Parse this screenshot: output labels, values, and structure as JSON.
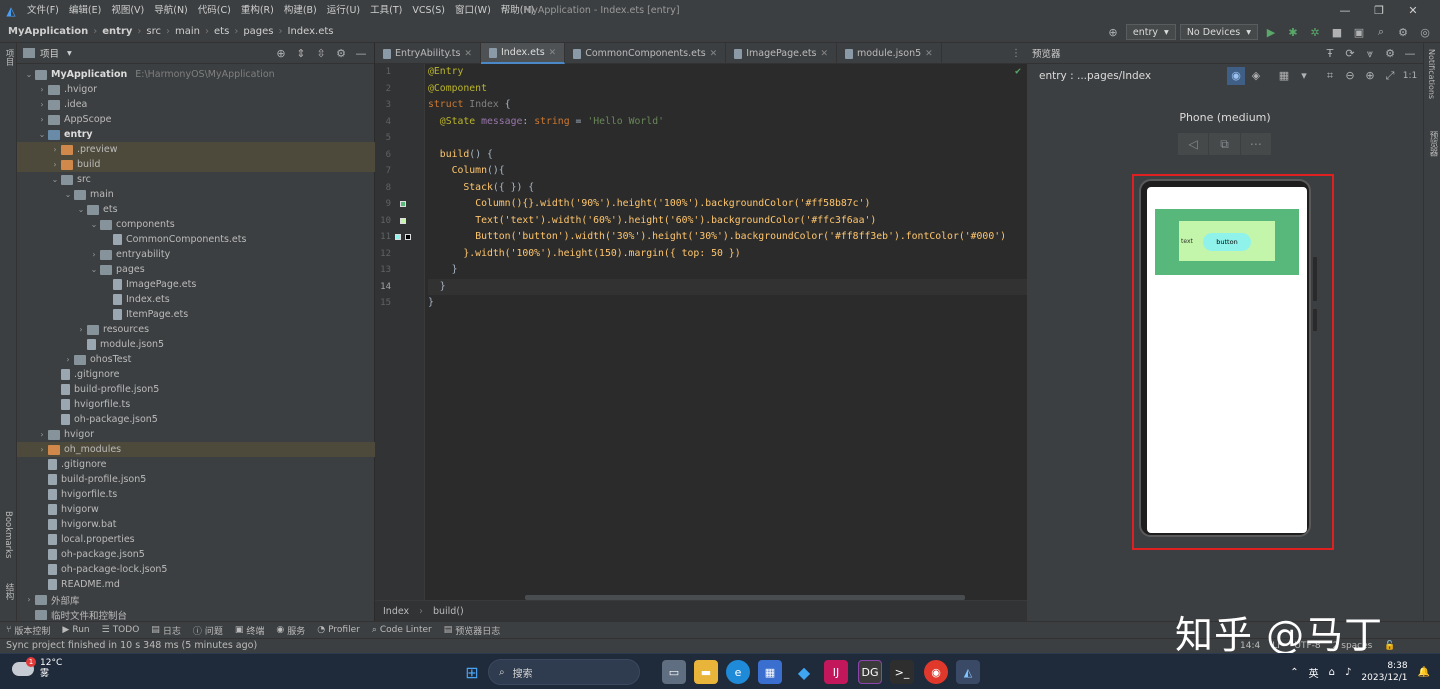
{
  "menubar": {
    "items": [
      "文件(F)",
      "编辑(E)",
      "视图(V)",
      "导航(N)",
      "代码(C)",
      "重构(R)",
      "构建(B)",
      "运行(U)",
      "工具(T)",
      "VCS(S)",
      "窗口(W)",
      "帮助(H)"
    ],
    "window_title": "MyApplication - Index.ets [entry]"
  },
  "navbar": {
    "crumbs": [
      "MyApplication",
      "entry",
      "src",
      "main",
      "ets",
      "pages",
      "Index.ets"
    ],
    "run_config": "entry",
    "devices": "No Devices"
  },
  "left_strip": {
    "top_label": "项目",
    "bookmarks": "Bookmarks",
    "structure": "结构"
  },
  "project": {
    "title": "项目",
    "nodes": [
      {
        "label": "MyApplication",
        "path": "E:\\HarmonyOS\\MyApplication"
      },
      {
        "label": ".hvigor"
      },
      {
        "label": ".idea"
      },
      {
        "label": "AppScope"
      },
      {
        "label": "entry"
      },
      {
        "label": ".preview"
      },
      {
        "label": "build"
      },
      {
        "label": "src"
      },
      {
        "label": "main"
      },
      {
        "label": "ets"
      },
      {
        "label": "components"
      },
      {
        "label": "CommonComponents.ets"
      },
      {
        "label": "entryability"
      },
      {
        "label": "pages"
      },
      {
        "label": "ImagePage.ets"
      },
      {
        "label": "Index.ets"
      },
      {
        "label": "ItemPage.ets"
      },
      {
        "label": "resources"
      },
      {
        "label": "module.json5"
      },
      {
        "label": "ohosTest"
      },
      {
        "label": ".gitignore"
      },
      {
        "label": "build-profile.json5"
      },
      {
        "label": "hvigorfile.ts"
      },
      {
        "label": "oh-package.json5"
      },
      {
        "label": "hvigor"
      },
      {
        "label": "oh_modules"
      },
      {
        "label": ".gitignore"
      },
      {
        "label": "build-profile.json5"
      },
      {
        "label": "hvigorfile.ts"
      },
      {
        "label": "hvigorw"
      },
      {
        "label": "hvigorw.bat"
      },
      {
        "label": "local.properties"
      },
      {
        "label": "oh-package.json5"
      },
      {
        "label": "oh-package-lock.json5"
      },
      {
        "label": "README.md"
      },
      {
        "label": "外部库"
      },
      {
        "label": "临时文件和控制台"
      }
    ]
  },
  "editor": {
    "tabs": [
      "EntryAbility.ts",
      "Index.ets",
      "CommonComponents.ets",
      "ImagePage.ets",
      "module.json5"
    ],
    "line_numbers": [
      "1",
      "2",
      "3",
      "4",
      "5",
      "6",
      "7",
      "8",
      "9",
      "10",
      "11",
      "12",
      "13",
      "14",
      "15"
    ],
    "code": {
      "l1": "@Entry",
      "l2": "@Component",
      "l3_kw": "struct",
      "l3_name": "Index",
      "l3_brace": "{",
      "l4_deco": "@State",
      "l4_var": "message",
      "l4_colon": ":",
      "l4_type": "string",
      "l4_eq": "=",
      "l4_val": "'Hello World'",
      "l6_fn": "build",
      "l6_rest": "() {",
      "l7_fn": "Column",
      "l7_rest": "(){",
      "l8_fn": "Stack",
      "l8_rest": "({ }) {",
      "l9": "Column(){}.width('90%').height('100%').backgroundColor('#ff58b87c')",
      "l10": "Text('text').width('60%').height('60%').backgroundColor('#ffc3f6aa')",
      "l11": "Button('button').width('30%').height('30%').backgroundColor('#ff8ff3eb').fontColor('#000')",
      "l12": "}.width('100%').height(150).margin({ top: 50 })",
      "l13": "}",
      "l14": "}",
      "l15": "}"
    },
    "breadcrumb": [
      "Index",
      "build()"
    ]
  },
  "preview": {
    "title": "预览器",
    "route": "entry : ...pages/Index",
    "device_name": "Phone (medium)",
    "text_label": "text",
    "button_label": "button"
  },
  "right_strip": {
    "notifications": "Notifications",
    "previewer": "预览器"
  },
  "bottombar": {
    "items": [
      "版本控制",
      "Run",
      "TODO",
      "日志",
      "问题",
      "终端",
      "服务",
      "Profiler",
      "Code Linter",
      "预览器日志"
    ]
  },
  "statusbar": {
    "message": "Sync project finished in 10 s 348 ms (5 minutes ago)",
    "pos": "14:4",
    "lf": "LF",
    "enc": "UTF-8",
    "indent": "2 spaces"
  },
  "watermark": "知乎 @马丁",
  "taskbar": {
    "temp": "12°C",
    "weather": "雾",
    "badge": "1",
    "search": "搜索",
    "ime": "英",
    "time": "8:38",
    "date": "2023/12/1"
  }
}
